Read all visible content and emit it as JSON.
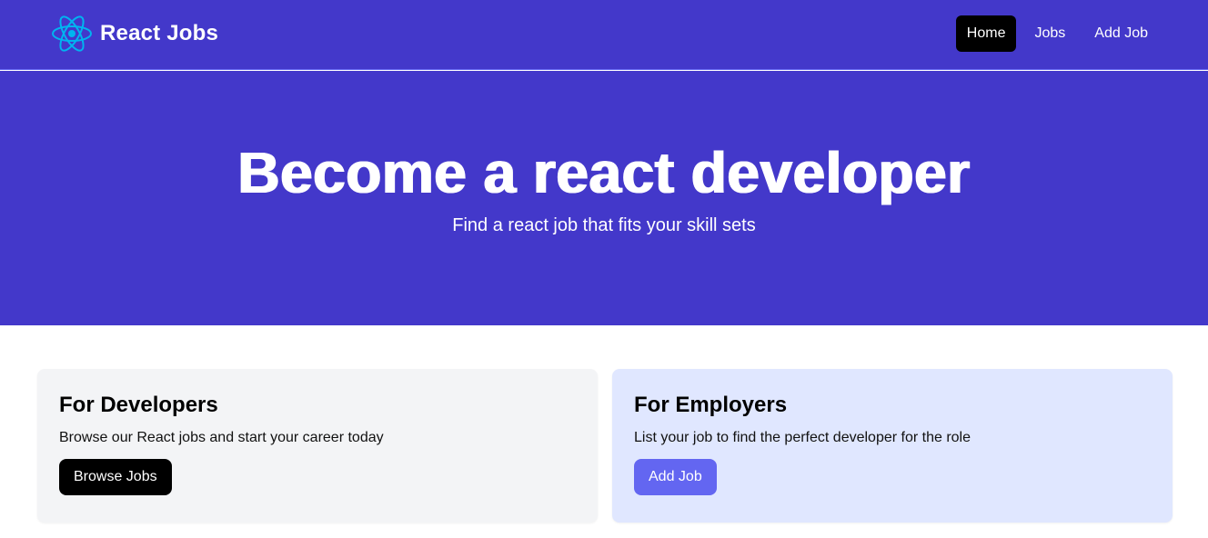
{
  "navbar": {
    "brand": {
      "name": "React Jobs",
      "logo_icon": "react-logo-icon",
      "logo_color": "#00b4f0"
    },
    "links": [
      {
        "label": "Home",
        "active": true
      },
      {
        "label": "Jobs",
        "active": false
      },
      {
        "label": "Add Job",
        "active": false
      }
    ]
  },
  "hero": {
    "title": "Become a react developer",
    "subtitle": "Find a react job that fits your skill sets"
  },
  "cards": [
    {
      "title": "For Developers",
      "text": "Browse our React jobs and start your career today",
      "button_label": "Browse Jobs"
    },
    {
      "title": "For Employers",
      "text": "List your job to find the perfect developer for the role",
      "button_label": "Add Job"
    }
  ],
  "colors": {
    "primary": "#4338ca",
    "active_nav": "#000000",
    "developers_card_bg": "#f3f4f6",
    "employers_card_bg": "#e0e7ff",
    "employers_button": "#6366f1"
  }
}
